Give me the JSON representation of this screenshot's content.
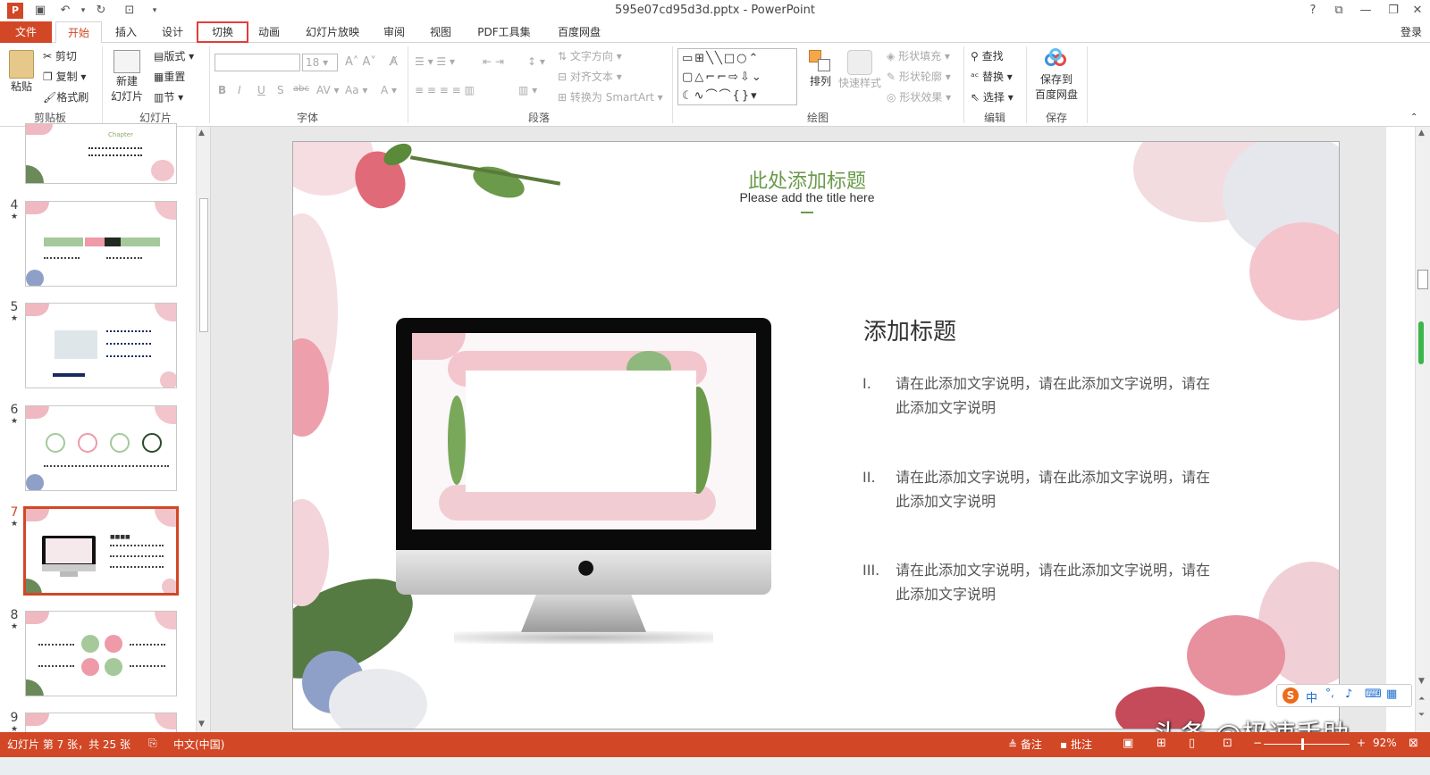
{
  "window": {
    "title": "595e07cd95d3d.pptx - PowerPoint",
    "help": "?",
    "login": "登录"
  },
  "tabs": [
    "文件",
    "开始",
    "插入",
    "设计",
    "切换",
    "动画",
    "幻灯片放映",
    "审阅",
    "视图",
    "PDF工具集",
    "百度网盘"
  ],
  "ribbon": {
    "clipboard": {
      "paste": "粘贴",
      "cut": "剪切",
      "copy": "复制",
      "format_painter": "格式刷",
      "label": "剪贴板"
    },
    "slides": {
      "new_slide_1": "新建",
      "new_slide_2": "幻灯片",
      "layout": "版式",
      "reset": "重置",
      "section": "节",
      "label": "幻灯片"
    },
    "font": {
      "size": "18",
      "bold": "B",
      "italic": "I",
      "underline": "U",
      "shadow": "S",
      "strike": "abc",
      "label": "字体"
    },
    "paragraph": {
      "text_direction": "文字方向",
      "align_text": "对齐文本",
      "smartart": "转换为 SmartArt",
      "label": "段落"
    },
    "drawing": {
      "arrange": "排列",
      "quick_styles": "快速样式",
      "shape_fill": "形状填充",
      "shape_outline": "形状轮廓",
      "shape_effects": "形状效果",
      "label": "绘图"
    },
    "editing": {
      "find": "查找",
      "replace": "替换",
      "select": "选择",
      "label": "编辑"
    },
    "save": {
      "save_to_1": "保存到",
      "save_to_2": "百度网盘",
      "label": "保存"
    }
  },
  "thumbnails": [
    {
      "num": "",
      "star": "",
      "selected": false,
      "text": "Chapter"
    },
    {
      "num": "4",
      "star": "★",
      "selected": false
    },
    {
      "num": "5",
      "star": "★",
      "selected": false
    },
    {
      "num": "6",
      "star": "★",
      "selected": false
    },
    {
      "num": "7",
      "star": "★",
      "selected": true
    },
    {
      "num": "8",
      "star": "★",
      "selected": false
    },
    {
      "num": "9",
      "star": "★",
      "selected": false
    }
  ],
  "slide": {
    "title_cn": "此处添加标题",
    "title_en": "Please add the title here",
    "heading": "添加标题",
    "items": [
      {
        "num": "I.",
        "line1": "请在此添加文字说明，请在此添加文字说明，请在",
        "line2": "此添加文字说明"
      },
      {
        "num": "II.",
        "line1": "请在此添加文字说明，请在此添加文字说明，请在",
        "line2": "此添加文字说明"
      },
      {
        "num": "III.",
        "line1": "请在此添加文字说明，请在此添加文字说明，请在",
        "line2": "此添加文字说明"
      }
    ]
  },
  "statusbar": {
    "slide_info": "幻灯片 第 7 张，共 25 张",
    "language": "中文(中国)",
    "notes": "备注",
    "comments": "批注",
    "zoom": "92%"
  },
  "ime": {
    "label": "中"
  },
  "watermark": "头条 @极速手助",
  "colors": {
    "accent": "#d24726",
    "title_green": "#6a9a4a"
  }
}
